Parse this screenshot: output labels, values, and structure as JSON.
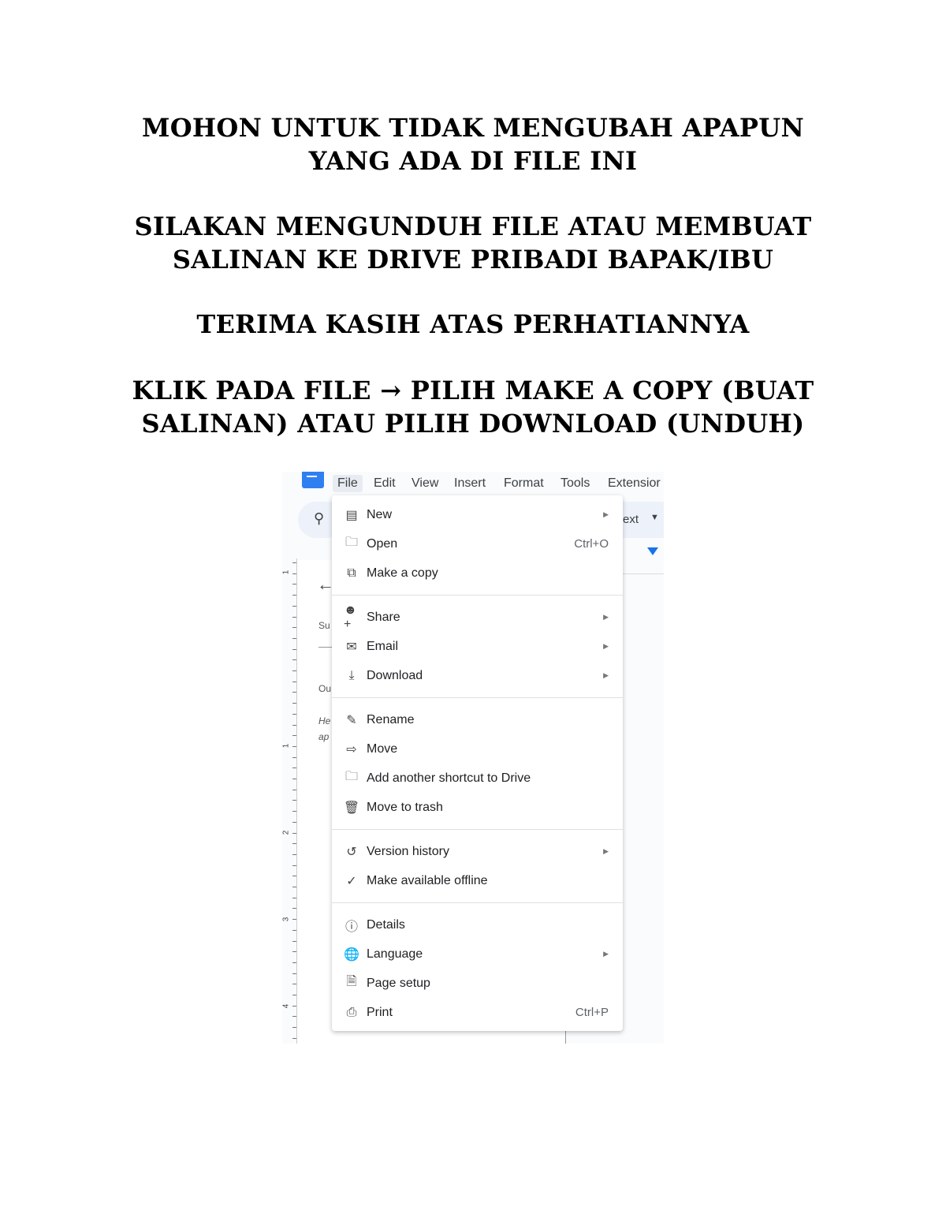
{
  "headings": [
    "MOHON UNTUK TIDAK MENGUBAH APAPUN",
    "YANG ADA DI FILE INI",
    "SILAKAN MENGUNDUH FILE ATAU MEMBUAT",
    "SALINAN KE DRIVE PRIBADI BAPAK/IBU",
    "TERIMA KASIH ATAS PERHATIANNYA",
    "KLIK PADA FILE → PILIH MAKE A COPY (BUAT",
    "SALINAN) ATAU PILIH DOWNLOAD (UNDUH)"
  ],
  "screenshot": {
    "menubar": [
      "File",
      "Edit",
      "View",
      "Insert",
      "Format",
      "Tools",
      "Extensior"
    ],
    "toolbar_text": "ext",
    "ruler_numbers": [
      "1",
      "1",
      "2",
      "3",
      "4"
    ],
    "doc_fragments": [
      "Su",
      "Ou",
      "He",
      "ap"
    ],
    "accent_color": "#1a73e8",
    "file_menu": {
      "groups": [
        [
          {
            "label": "New",
            "icon": "doc-icon",
            "submenu": true
          },
          {
            "label": "Open",
            "icon": "folder-icon",
            "shortcut": "Ctrl+O"
          },
          {
            "label": "Make a copy",
            "icon": "copy-icon"
          }
        ],
        [
          {
            "label": "Share",
            "icon": "person-add-icon",
            "submenu": true
          },
          {
            "label": "Email",
            "icon": "mail-icon",
            "submenu": true
          },
          {
            "label": "Download",
            "icon": "download-icon",
            "submenu": true
          }
        ],
        [
          {
            "label": "Rename",
            "icon": "pencil-icon"
          },
          {
            "label": "Move",
            "icon": "move-folder-icon"
          },
          {
            "label": "Add another shortcut to Drive",
            "icon": "folder-icon"
          },
          {
            "label": "Move to trash",
            "icon": "trash-icon"
          }
        ],
        [
          {
            "label": "Version history",
            "icon": "history-icon",
            "submenu": true
          },
          {
            "label": "Make available offline",
            "icon": "offline-check-icon"
          }
        ],
        [
          {
            "label": "Details",
            "icon": "info-icon"
          },
          {
            "label": "Language",
            "icon": "globe-icon",
            "submenu": true
          },
          {
            "label": "Page setup",
            "icon": "page-icon"
          },
          {
            "label": "Print",
            "icon": "printer-icon",
            "shortcut": "Ctrl+P"
          }
        ]
      ]
    }
  }
}
